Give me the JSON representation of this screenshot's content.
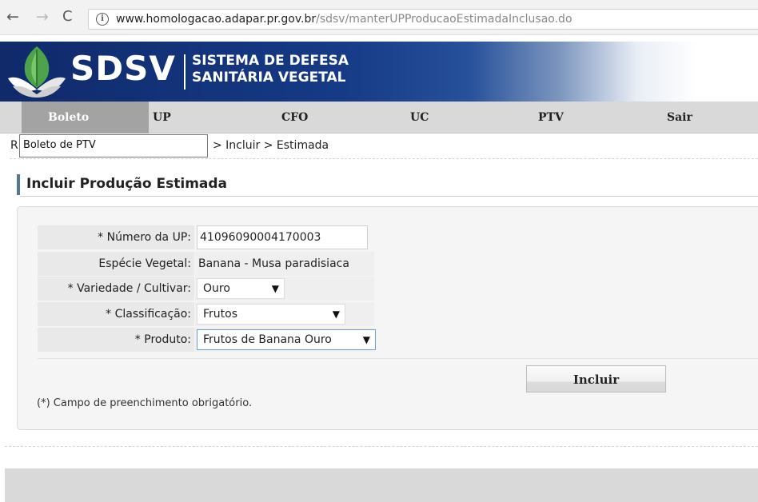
{
  "browser": {
    "url_host": "www.homologacao.adapar.pr.gov.br",
    "url_path": "/sdsv/manterUPProducaoEstimadaInclusao.do",
    "back_glyph": "←",
    "forward_glyph": "→",
    "reload_glyph": "C",
    "info_glyph": "i"
  },
  "header": {
    "logo_text": "SDSV",
    "subtitle_line1": "SISTEMA DE DEFESA",
    "subtitle_line2": "SANITÁRIA VEGETAL"
  },
  "menu": {
    "items": [
      {
        "label": "Boleto",
        "active": true
      },
      {
        "label": "UP"
      },
      {
        "label": "CFO"
      },
      {
        "label": "UC"
      },
      {
        "label": "PTV"
      },
      {
        "label": "Sair"
      }
    ],
    "dropdown_item": "Boleto de PTV"
  },
  "breadcrumb": {
    "start": "R",
    "rest": "> Incluir > Estimada"
  },
  "page": {
    "title": "Incluir Produção Estimada"
  },
  "form": {
    "numero_up": {
      "label": "* Número da UP:",
      "value": "41096090004170003"
    },
    "especie": {
      "label": "Espécie Vegetal:",
      "value": "Banana - Musa paradisiaca"
    },
    "variedade": {
      "label": "* Variedade / Cultivar:",
      "value": "Ouro"
    },
    "classificacao": {
      "label": "* Classificação:",
      "value": "Frutos"
    },
    "produto": {
      "label": "* Produto:",
      "value": "Frutos de Banana Ouro"
    },
    "arrow": "▼",
    "submit_label": "Incluir",
    "footnote": "(*) Campo de preenchimento obrigatório."
  },
  "colors": {
    "banner_dark": "#102a6a",
    "menu_active": "#a3a3a3",
    "title_accent": "#55798a",
    "focus_border": "#6f9ed6"
  }
}
